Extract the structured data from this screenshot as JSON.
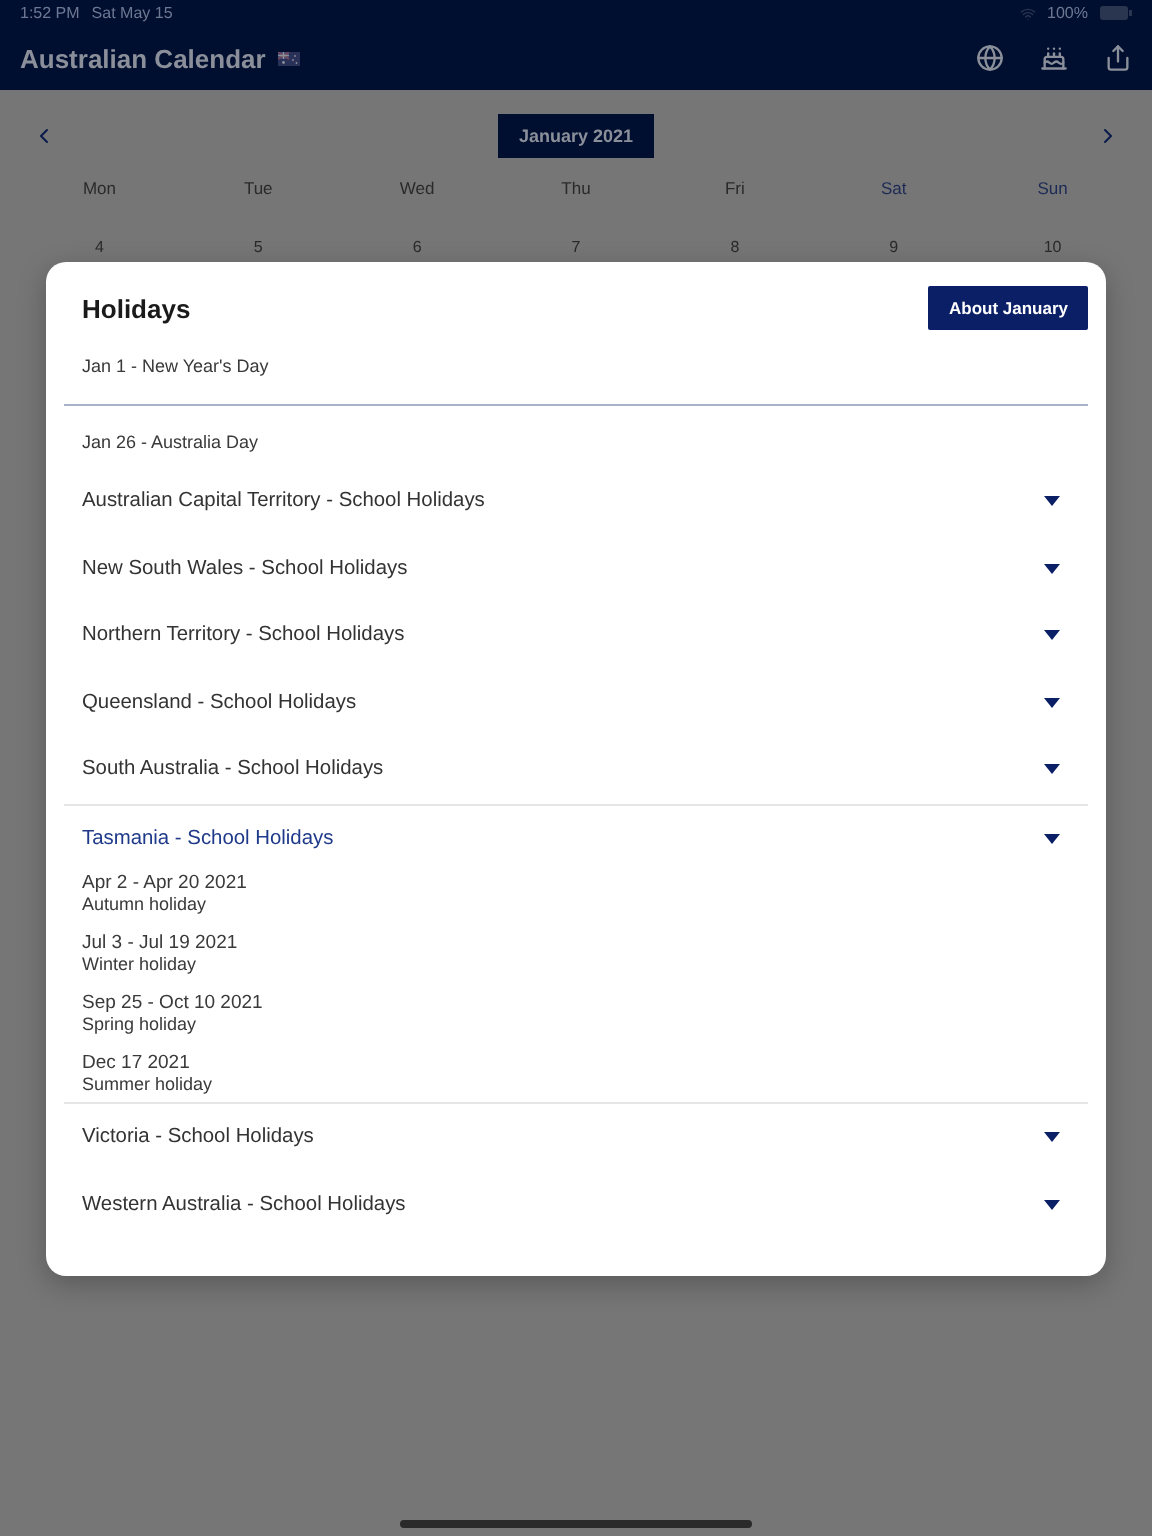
{
  "status_bar": {
    "time": "1:52 PM",
    "date": "Sat May 15",
    "battery": "100%"
  },
  "header": {
    "title": "Australian Calendar"
  },
  "calendar": {
    "month": "January 2021",
    "weekdays": [
      {
        "label": "Mon",
        "weekend": false
      },
      {
        "label": "Tue",
        "weekend": false
      },
      {
        "label": "Wed",
        "weekend": false
      },
      {
        "label": "Thu",
        "weekend": false
      },
      {
        "label": "Fri",
        "weekend": false
      },
      {
        "label": "Sat",
        "weekend": true
      },
      {
        "label": "Sun",
        "weekend": true
      }
    ],
    "days": [
      "4",
      "5",
      "6",
      "7",
      "8",
      "9",
      "10"
    ]
  },
  "dialog": {
    "title": "Holidays",
    "button": "About January",
    "items": [
      {
        "kind": "holiday",
        "label": "Jan 1 - New Year's Day"
      },
      {
        "kind": "holiday",
        "label": "Jan 26 - Australia Day"
      },
      {
        "kind": "region",
        "label": "Australian Capital Territory - School Holidays",
        "expanded": false
      },
      {
        "kind": "region",
        "label": "New South Wales - School Holidays",
        "expanded": false
      },
      {
        "kind": "region",
        "label": "Northern Territory - School Holidays",
        "expanded": false
      },
      {
        "kind": "region",
        "label": "Queensland - School Holidays",
        "expanded": false
      },
      {
        "kind": "region",
        "label": "South Australia - School Holidays",
        "expanded": false
      },
      {
        "kind": "region",
        "label": "Tasmania - School Holidays",
        "expanded": true,
        "children": [
          {
            "dates": "Apr 2 - Apr 20 2021",
            "name": "Autumn holiday"
          },
          {
            "dates": "Jul 3 - Jul 19 2021",
            "name": "Winter holiday"
          },
          {
            "dates": "Sep 25 - Oct 10 2021",
            "name": "Spring holiday"
          },
          {
            "dates": "Dec 17 2021",
            "name": "Summer holiday"
          }
        ]
      },
      {
        "kind": "region",
        "label": "Victoria - School Holidays",
        "expanded": false
      },
      {
        "kind": "region",
        "label": "Western Australia - School Holidays",
        "expanded": false
      }
    ]
  }
}
